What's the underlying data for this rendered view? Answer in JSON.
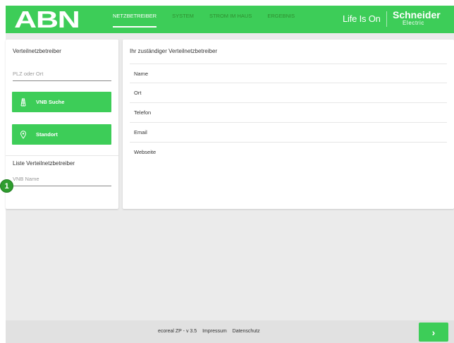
{
  "header": {
    "logo": "ABN",
    "nav": [
      "NETZBETREIBER",
      "SYSTEM",
      "STROM IM HAUS",
      "ERGEBNIS"
    ],
    "active_nav_index": 0,
    "tagline": "Life Is On",
    "brand_line1": "Schneider",
    "brand_line2": "Electric"
  },
  "left_panel": {
    "title": "Verteilnetzbetreiber",
    "plz_placeholder": "PLZ oder Ort",
    "search_button": "VNB Suche",
    "search_button_icon": "power-pylon-icon",
    "location_button": "Standort",
    "location_button_icon": "location-pin-icon",
    "list_title": "Liste Verteilnetzbetreiber",
    "name_placeholder": "VNB Name"
  },
  "right_panel": {
    "title": "Ihr zuständiger Verteilnetzbetreiber",
    "fields": [
      "Name",
      "Ort",
      "Telefon",
      "Email",
      "Webseite"
    ]
  },
  "footer": {
    "version": "ecoreal ZP - v 3.5",
    "impressum": "Impressum",
    "datenschutz": "Datenschutz",
    "next_icon": "chevron-right-icon",
    "next_label": "›"
  },
  "annotation": {
    "marker": "1"
  },
  "colors": {
    "accent": "#3dcd58",
    "background": "#ebebeb",
    "badge": "#2e9d2e"
  }
}
